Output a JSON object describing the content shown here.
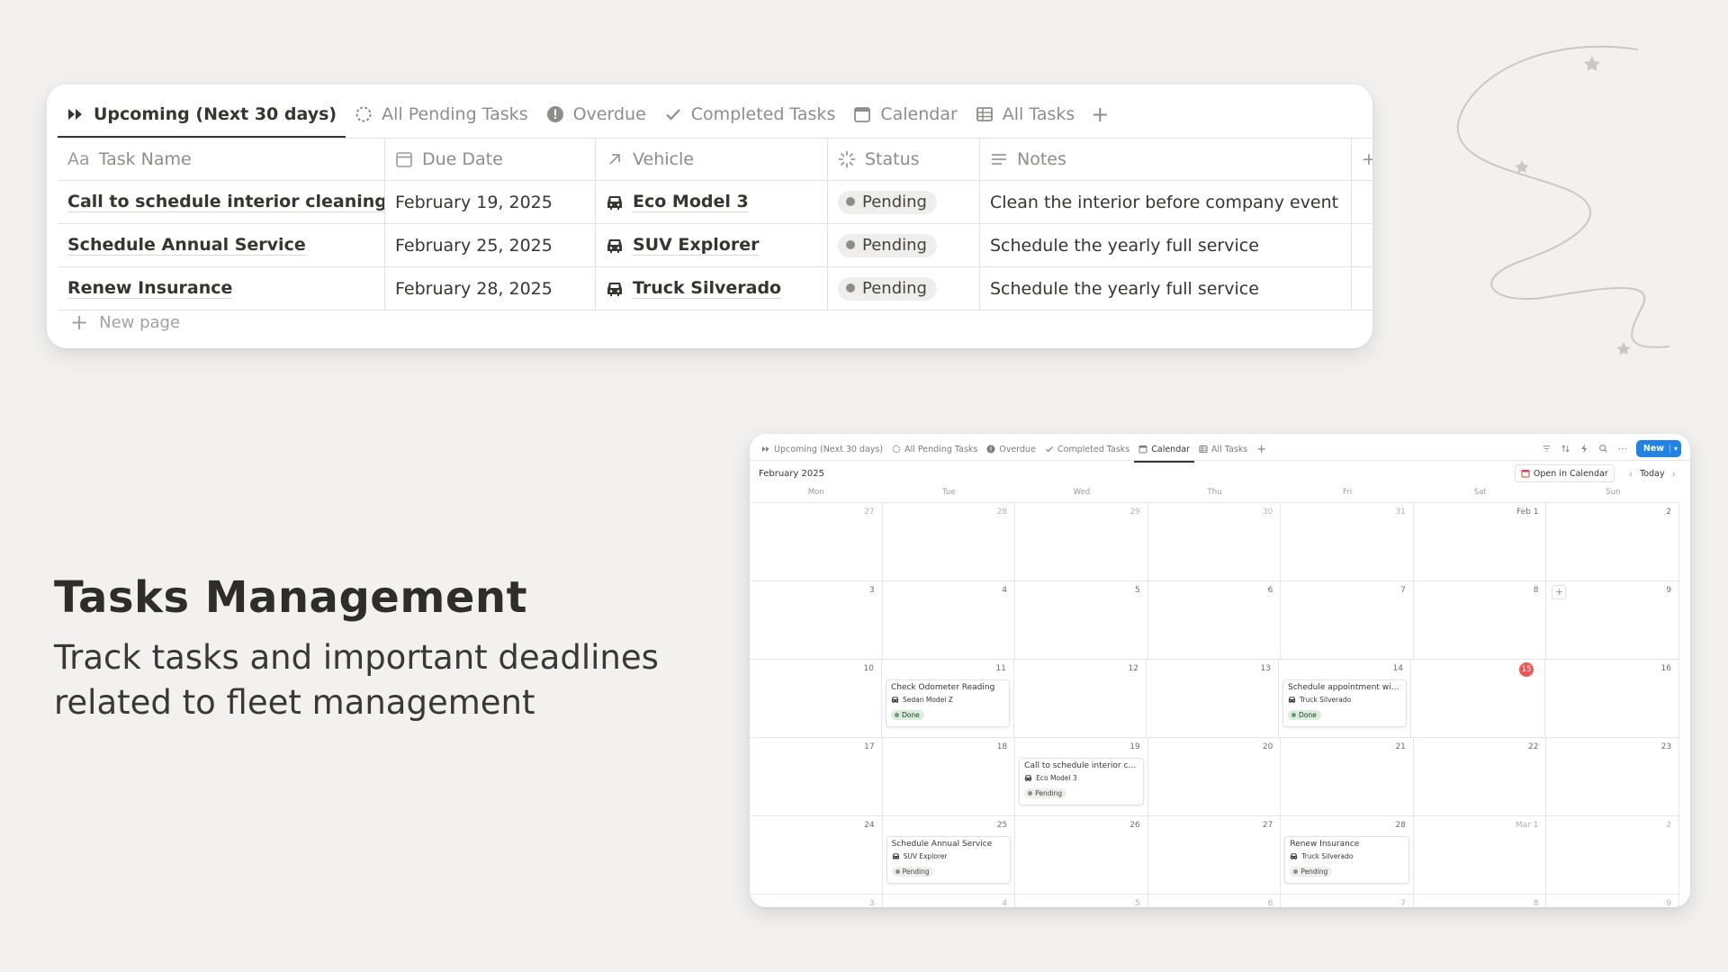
{
  "table_view": {
    "tabs": [
      {
        "label": "Upcoming (Next 30 days)",
        "icon": "double-arrow-icon",
        "active": true
      },
      {
        "label": "All Pending Tasks",
        "icon": "dashed-circle-icon",
        "active": false
      },
      {
        "label": "Overdue",
        "icon": "exclamation-circle-icon",
        "active": false
      },
      {
        "label": "Completed Tasks",
        "icon": "checkmark-icon",
        "active": false
      },
      {
        "label": "Calendar",
        "icon": "calendar-icon",
        "active": false
      },
      {
        "label": "All Tasks",
        "icon": "table-icon",
        "active": false
      }
    ],
    "columns": {
      "task_name": "Task Name",
      "task_name_prefix": "Aa",
      "due_date": "Due Date",
      "vehicle": "Vehicle",
      "status": "Status",
      "notes": "Notes"
    },
    "rows": [
      {
        "task": "Call to schedule interior cleaning",
        "due": "February 19, 2025",
        "vehicle": "Eco Model 3",
        "status": "Pending",
        "notes": "Clean the interior before company event"
      },
      {
        "task": "Schedule Annual Service",
        "due": "February 25, 2025",
        "vehicle": "SUV Explorer",
        "status": "Pending",
        "notes": "Schedule the yearly full service"
      },
      {
        "task": "Renew Insurance",
        "due": "February 28, 2025",
        "vehicle": "Truck Silverado",
        "status": "Pending",
        "notes": "Schedule the yearly full service"
      }
    ],
    "new_page": "New page"
  },
  "headline": "Tasks Management",
  "subline_1": "Track tasks and important deadlines",
  "subline_2": "related to fleet management",
  "calendar_view": {
    "tabs": [
      {
        "label": "Upcoming (Next 30 days)",
        "icon": "double-arrow-icon"
      },
      {
        "label": "All Pending Tasks",
        "icon": "dashed-circle-icon"
      },
      {
        "label": "Overdue",
        "icon": "exclamation-circle-icon"
      },
      {
        "label": "Completed Tasks",
        "icon": "checkmark-icon"
      },
      {
        "label": "Calendar",
        "icon": "calendar-icon",
        "active": true
      },
      {
        "label": "All Tasks",
        "icon": "table-icon"
      }
    ],
    "new_button": "New",
    "month_label": "February 2025",
    "open_in_calendar": "Open in Calendar",
    "today": "Today",
    "weekdays": [
      "Mon",
      "Tue",
      "Wed",
      "Thu",
      "Fri",
      "Sat",
      "Sun"
    ],
    "weeks": [
      [
        "27",
        "28",
        "29",
        "30",
        "31",
        "Feb 1",
        "2"
      ],
      [
        "3",
        "4",
        "5",
        "6",
        "7",
        "8",
        "9"
      ],
      [
        "10",
        "11",
        "12",
        "13",
        "14",
        "15",
        "16"
      ],
      [
        "17",
        "18",
        "19",
        "20",
        "21",
        "22",
        "23"
      ],
      [
        "24",
        "25",
        "26",
        "27",
        "28",
        "Mar 1",
        "2"
      ],
      [
        "3",
        "4",
        "5",
        "6",
        "7",
        "8",
        "9"
      ]
    ],
    "today_date": "15",
    "events": [
      {
        "week": 2,
        "day": 1,
        "title": "Check Odometer Reading",
        "vehicle": "Sedan Model Z",
        "status": "Done"
      },
      {
        "week": 2,
        "day": 4,
        "title": "Schedule appointment with...",
        "vehicle": "Truck Silverado",
        "status": "Done"
      },
      {
        "week": 3,
        "day": 2,
        "title": "Call to schedule interior cle...",
        "vehicle": "Eco Model 3",
        "status": "Pending"
      },
      {
        "week": 4,
        "day": 1,
        "title": "Schedule Annual Service",
        "vehicle": "SUV Explorer",
        "status": "Pending"
      },
      {
        "week": 4,
        "day": 4,
        "title": "Renew Insurance",
        "vehicle": "Truck Silverado",
        "status": "Pending"
      }
    ]
  },
  "colors": {
    "background": "#f2f1ef",
    "accent_blue": "#2383e2",
    "today_red": "#eb5757",
    "done_green": "#dbeddb",
    "pending_gray": "#efeeec"
  }
}
